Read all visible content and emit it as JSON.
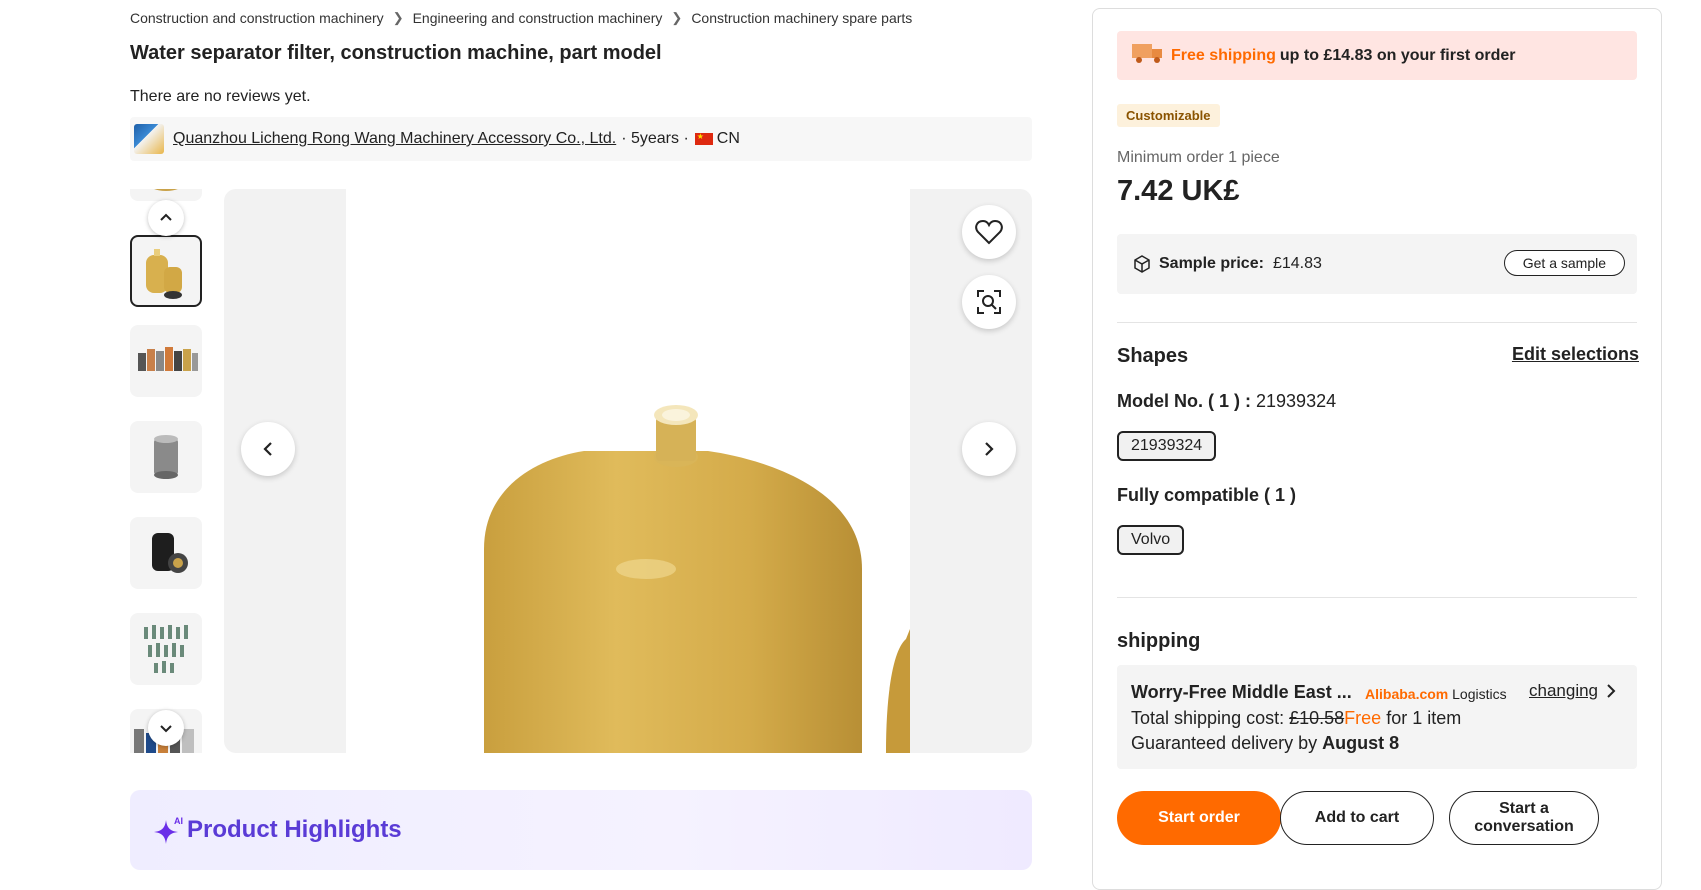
{
  "breadcrumb": [
    "Construction and construction machinery",
    "Engineering and construction machinery",
    "Construction machinery spare parts"
  ],
  "product": {
    "title": "Water separator filter, construction machine, part model",
    "reviews": "There are no reviews yet."
  },
  "supplier": {
    "name": "Quanzhou Licheng Rong Wang Machinery Accessory Co., Ltd.",
    "years": "· 5years ·",
    "country": "CN"
  },
  "gallery": {
    "active_index": 1,
    "thumbnail_count": 7
  },
  "highlights": {
    "title": "Product Highlights",
    "ai_badge": "AI"
  },
  "panel": {
    "shipping_banner": {
      "free": "Free shipping",
      "rest": "up to £14.83 on your first order"
    },
    "customizable": "Customizable",
    "min_order": "Minimum order 1 piece",
    "price": "7.42 UK£",
    "sample": {
      "label": "Sample price:",
      "value": "£14.83",
      "button": "Get a sample"
    },
    "shapes": {
      "title": "Shapes",
      "edit": "Edit selections",
      "model_label": "Model No. ( 1 ) :",
      "model_value": "21939324",
      "model_chip": "21939324",
      "compat_label": "Fully compatible ( 1 )",
      "compat_chip": "Volvo"
    },
    "shipping": {
      "title": "shipping",
      "method": "Worry-Free Middle East ...",
      "brand_ali": "Alibaba.com",
      "brand_rest": "Logistics",
      "change": "changing",
      "cost_prefix": "Total shipping cost:",
      "cost_old": "£10.58",
      "cost_free": "Free",
      "cost_suffix": "for 1 item",
      "delivery_prefix": "Guaranteed delivery by",
      "delivery_date": "August 8"
    },
    "actions": {
      "start_order": "Start order",
      "add_to_cart": "Add to cart",
      "conversation": "Start a conversation"
    }
  },
  "colors": {
    "accent": "#ff6a00",
    "banner_bg": "#ffe5e2",
    "filter_yellow": "#d8b04e",
    "highlight_purple": "#5a3bd6"
  }
}
